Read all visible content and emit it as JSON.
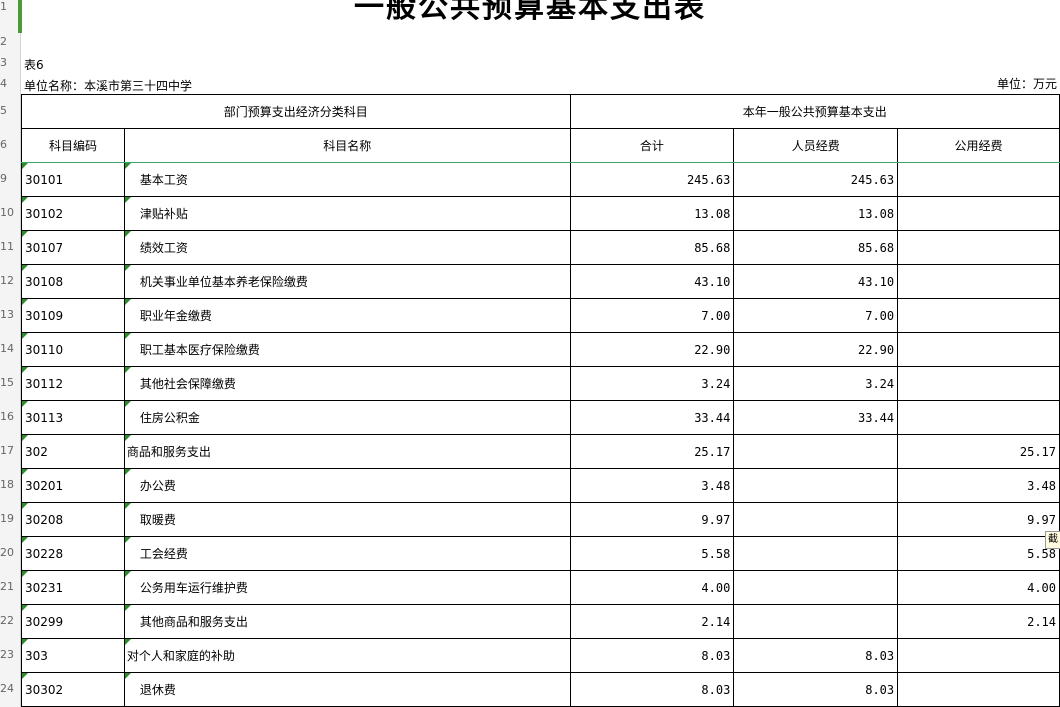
{
  "title": "一般公共预算基本支出表",
  "table_no": "表6",
  "unit_name": "单位名称：本溪市第三十四中学",
  "unit": "单位：万元",
  "row_numbers": [
    "1",
    "2",
    "3",
    "4",
    "5",
    "6",
    "9",
    "10",
    "11",
    "12",
    "13",
    "14",
    "15",
    "16",
    "17",
    "18",
    "19",
    "20",
    "21",
    "22",
    "23",
    "24"
  ],
  "header": {
    "group_left": "部门预算支出经济分类科目",
    "group_right": "本年一般公共预算基本支出",
    "col_code": "科目编码",
    "col_name": "科目名称",
    "col_total": "合计",
    "col_personnel": "人员经费",
    "col_public": "公用经费"
  },
  "rows": [
    {
      "code": "30101",
      "name": "基本工资",
      "total": "245.63",
      "personnel": "245.63",
      "public": ""
    },
    {
      "code": "30102",
      "name": "津贴补贴",
      "total": "13.08",
      "personnel": "13.08",
      "public": ""
    },
    {
      "code": "30107",
      "name": "绩效工资",
      "total": "85.68",
      "personnel": "85.68",
      "public": ""
    },
    {
      "code": "30108",
      "name": "机关事业单位基本养老保险缴费",
      "total": "43.10",
      "personnel": "43.10",
      "public": ""
    },
    {
      "code": "30109",
      "name": "职业年金缴费",
      "total": "7.00",
      "personnel": "7.00",
      "public": ""
    },
    {
      "code": "30110",
      "name": "职工基本医疗保险缴费",
      "total": "22.90",
      "personnel": "22.90",
      "public": ""
    },
    {
      "code": "30112",
      "name": "其他社会保障缴费",
      "total": "3.24",
      "personnel": "3.24",
      "public": ""
    },
    {
      "code": "30113",
      "name": "住房公积金",
      "total": "33.44",
      "personnel": "33.44",
      "public": ""
    },
    {
      "code": "302",
      "name": "商品和服务支出",
      "total": "25.17",
      "personnel": "",
      "public": "25.17"
    },
    {
      "code": "30201",
      "name": "办公费",
      "total": "3.48",
      "personnel": "",
      "public": "3.48"
    },
    {
      "code": "30208",
      "name": "取暖费",
      "total": "9.97",
      "personnel": "",
      "public": "9.97"
    },
    {
      "code": "30228",
      "name": "工会经费",
      "total": "5.58",
      "personnel": "",
      "public": "5.58"
    },
    {
      "code": "30231",
      "name": "公务用车运行维护费",
      "total": "4.00",
      "personnel": "",
      "public": "4.00"
    },
    {
      "code": "30299",
      "name": "其他商品和服务支出",
      "total": "2.14",
      "personnel": "",
      "public": "2.14"
    },
    {
      "code": "303",
      "name": "对个人和家庭的补助",
      "total": "8.03",
      "personnel": "8.03",
      "public": ""
    },
    {
      "code": "30302",
      "name": "退休费",
      "total": "8.03",
      "personnel": "8.03",
      "public": ""
    }
  ],
  "tooltip_char": "截"
}
